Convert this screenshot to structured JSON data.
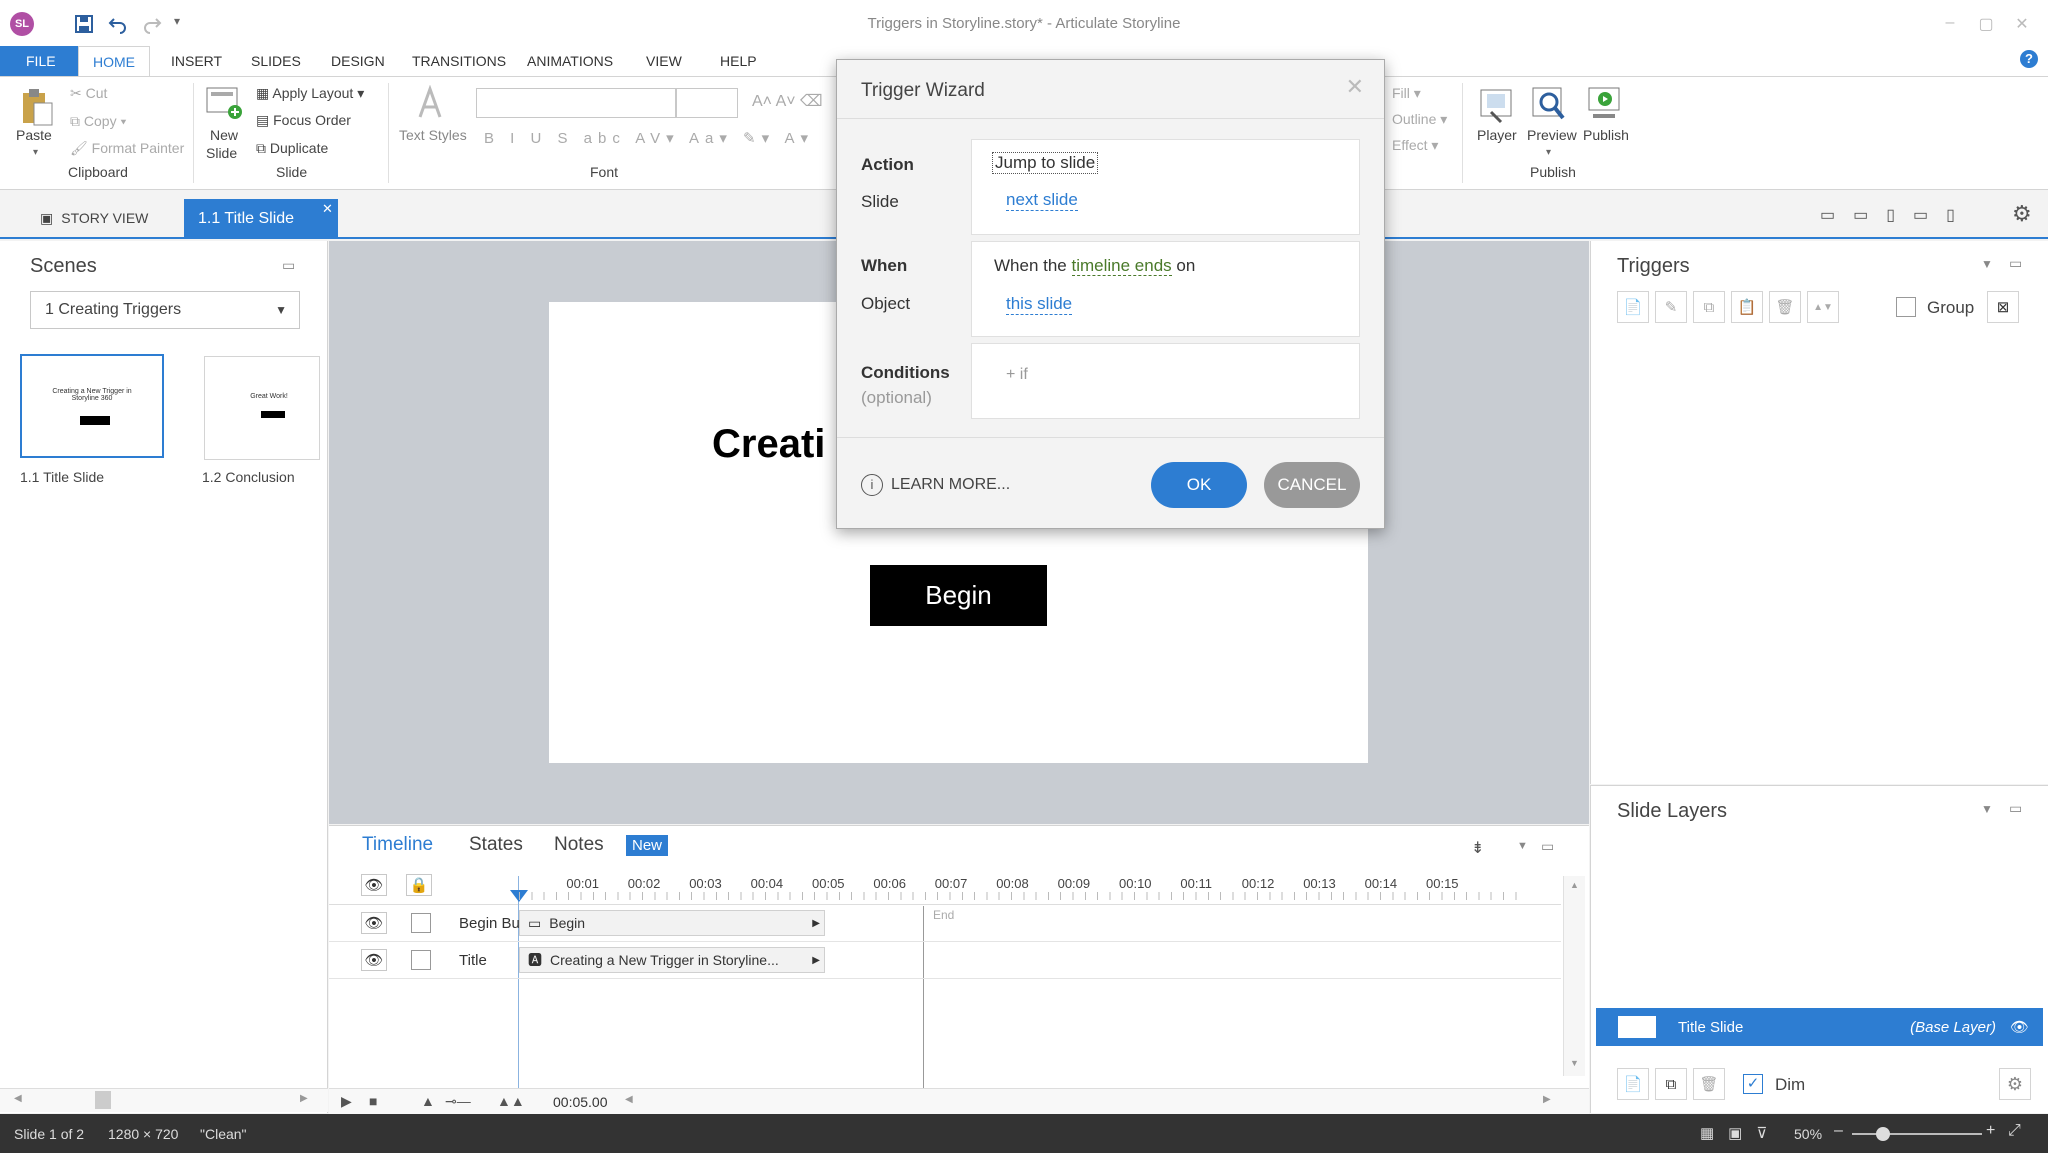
{
  "window": {
    "title": "Triggers in Storyline.story* - Articulate Storyline",
    "app_logo": "SL"
  },
  "ribbon_tabs": [
    "FILE",
    "HOME",
    "INSERT",
    "SLIDES",
    "DESIGN",
    "TRANSITIONS",
    "ANIMATIONS",
    "VIEW",
    "HELP"
  ],
  "ribbon": {
    "clipboard": {
      "paste": "Paste",
      "cut": "Cut",
      "copy": "Copy",
      "format_painter": "Format Painter",
      "label": "Clipboard"
    },
    "slide": {
      "new_slide_1": "New",
      "new_slide_2": "Slide",
      "apply_layout": "Apply Layout",
      "focus_order": "Focus Order",
      "duplicate": "Duplicate",
      "label": "Slide"
    },
    "font": {
      "text_styles": "Text Styles",
      "label": "Font"
    },
    "shape": {
      "fill": "Fill",
      "outline": "Outline",
      "effect": "Effect"
    },
    "publish": {
      "player": "Player",
      "preview": "Preview",
      "publish": "Publish",
      "label": "Publish"
    }
  },
  "doc_tabs": {
    "story_view": "STORY VIEW",
    "current_slide": "1.1 Title Slide"
  },
  "scenes": {
    "title": "Scenes",
    "selected_scene": "1 Creating Triggers",
    "thumbnails": [
      {
        "label": "1.1 Title Slide",
        "preview_title": "Creating a New Trigger in Storyline 360"
      },
      {
        "label": "1.2 Conclusion",
        "preview_title": "Great Work!"
      }
    ]
  },
  "slide": {
    "title_text": "Creati",
    "button_text": "Begin"
  },
  "triggers": {
    "title": "Triggers",
    "group_label": "Group"
  },
  "layers": {
    "title": "Slide Layers",
    "base_layer_name": "Title Slide",
    "base_layer_tag": "(Base Layer)",
    "dim_label": "Dim"
  },
  "timeline": {
    "tabs": [
      "Timeline",
      "States",
      "Notes"
    ],
    "new_badge": "New",
    "ticks": [
      "00:01",
      "00:02",
      "00:03",
      "00:04",
      "00:05",
      "00:06",
      "00:07",
      "00:08",
      "00:09",
      "00:10",
      "00:11",
      "00:12",
      "00:13",
      "00:14",
      "00:15"
    ],
    "end_label": "End",
    "rows": [
      {
        "name": "Begin Button",
        "bar": "Begin"
      },
      {
        "name": "Title",
        "bar": "Creating a New Trigger in Storyline..."
      }
    ],
    "duration": "00:05.00"
  },
  "status": {
    "slide_count": "Slide 1 of 2",
    "dimensions": "1280 × 720",
    "theme": "\"Clean\"",
    "zoom": "50%"
  },
  "dialog": {
    "title": "Trigger Wizard",
    "action_label": "Action",
    "action_value": "Jump to slide",
    "slide_label": "Slide",
    "slide_value": "next slide",
    "when_label": "When",
    "when_prefix": "When the",
    "when_value": "timeline ends",
    "when_suffix": "on",
    "object_label": "Object",
    "object_value": "this slide",
    "conditions_label": "Conditions",
    "conditions_optional": "(optional)",
    "add_condition": "+ if",
    "learn_more": "LEARN MORE...",
    "ok": "OK",
    "cancel": "CANCEL"
  },
  "colors": {
    "accent": "#2d7dd2",
    "status_bar": "#333333",
    "stage": "#c8ccd2"
  }
}
